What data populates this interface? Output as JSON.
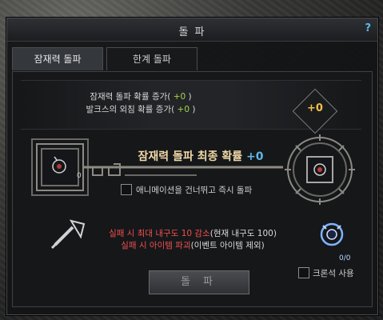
{
  "window": {
    "title": "돌 파",
    "help": "?"
  },
  "tabs": [
    {
      "label": "잠재력 돌파",
      "active": true
    },
    {
      "label": "한계 돌파",
      "active": false
    }
  ],
  "info": {
    "line1_prefix": "잠재력 돌파 확률 증가(",
    "line1_value": " +0 ",
    "line1_suffix": ")",
    "line2_prefix": "발크스의 외침 확률 증가(",
    "line2_value": " +0 ",
    "line2_suffix": ")",
    "bonus_value": "+0"
  },
  "final": {
    "label": "잠재력 돌파 최종 확률",
    "value": "+0"
  },
  "slots": {
    "left_count": "0"
  },
  "skip_animation": {
    "label": "애니메이션을 건너뛰고 즉시 돌파",
    "checked": false
  },
  "fail": {
    "line1_red": "실패 시 최대 내구도 10 감소",
    "line1_rest": "(현재 내구도 100)",
    "line2_red": "실패 시 아이템 파괴",
    "line2_rest": "(이벤트 아이템 제외)"
  },
  "cron": {
    "count": "0/0",
    "label": "크론석 사용",
    "checked": false
  },
  "action": {
    "label": "돌 파"
  },
  "colors": {
    "accent_green": "#a6d64a",
    "accent_blue": "#5fb8e8",
    "fail_red": "#f05050",
    "gold": "#f1c04a"
  },
  "icons": [
    "help-icon",
    "potion-icon",
    "sword-icon",
    "cron-stone-icon",
    "key-frame"
  ]
}
